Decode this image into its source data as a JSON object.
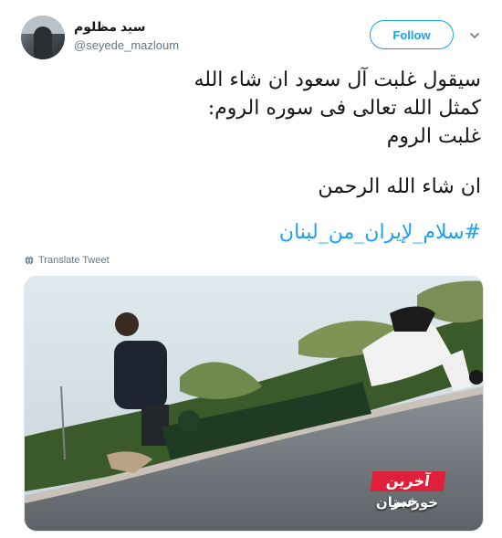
{
  "author": {
    "display_name": "سيد مظلوم",
    "handle": "@seyede_mazloum"
  },
  "follow_button_label": "Follow",
  "tweet": {
    "lines": [
      "سيقول غلبت آل سعود ان شاء الله",
      "كمثل الله تعالى فى سوره الروم:",
      "غلبت الروم"
    ],
    "closing_line": "ان شاء الله الرحمن",
    "hashtag": "#سلام_لإيران_من_لبنان"
  },
  "translate_label": "Translate Tweet",
  "media": {
    "badge_top": "آخرین خبر",
    "badge_bottom": "خوزستان"
  },
  "colors": {
    "accent": "#1da1f2",
    "badge_red": "#e0203a"
  },
  "icons": [
    "chevron-down-icon",
    "globe-icon"
  ]
}
